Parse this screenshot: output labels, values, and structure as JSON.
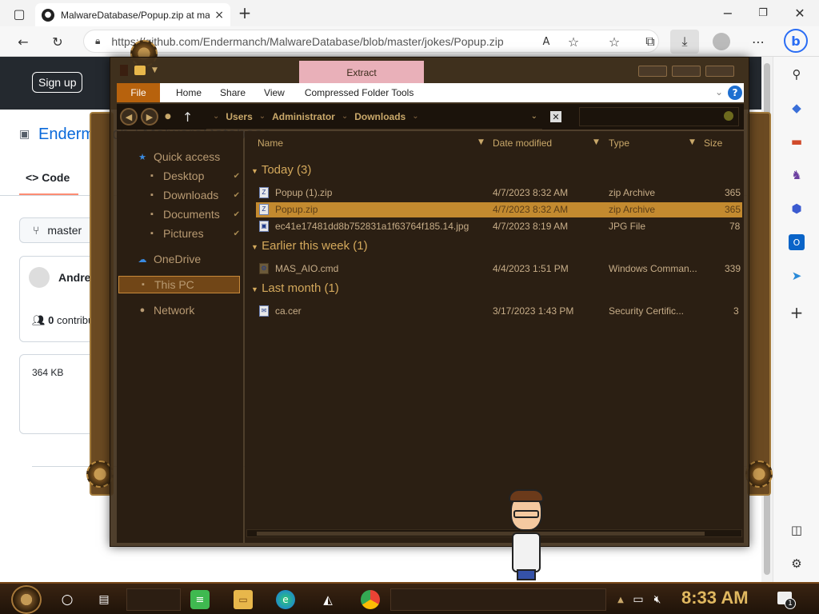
{
  "browser": {
    "tab_title": "MalwareDatabase/Popup.zip at master",
    "tab_close": "×",
    "url": "https://github.com/Endermanch/MalwareDatabase/blob/master/jokes/Popup.zip",
    "new_tab": "+"
  },
  "github": {
    "signup": "Sign up",
    "repo_name": "Endermanch / MalwareDatabase",
    "code_tab": "Code",
    "branch": "master",
    "author": "Andrew",
    "contributors_count": "0",
    "contributors_label": "contributors",
    "file_size": "364 KB"
  },
  "explorer": {
    "contextual_tab": "Extract",
    "ribbon": {
      "file": "File",
      "home": "Home",
      "share": "Share",
      "view": "View",
      "tools": "Compressed Folder Tools",
      "help": "?"
    },
    "breadcrumbs": [
      "Users",
      "Administrator",
      "Downloads"
    ],
    "columns": {
      "name": "Name",
      "date": "Date modified",
      "type": "Type",
      "size": "Size"
    },
    "nav": {
      "quick_access": "Quick access",
      "desktop": "Desktop",
      "downloads": "Downloads",
      "documents": "Documents",
      "pictures": "Pictures",
      "onedrive": "OneDrive",
      "this_pc": "This PC",
      "network": "Network"
    },
    "groups": {
      "today": "Today (3)",
      "earlier": "Earlier this week (1)",
      "last_month": "Last month (1)"
    },
    "files": [
      {
        "name": "Popup (1).zip",
        "date": "4/7/2023 8:32 AM",
        "type": "zip Archive",
        "size": "365"
      },
      {
        "name": "Popup.zip",
        "date": "4/7/2023 8:32 AM",
        "type": "zip Archive",
        "size": "365"
      },
      {
        "name": "ec41e17481dd8b752831a1f63764f185.14.jpg",
        "date": "4/7/2023 8:19 AM",
        "type": "JPG File",
        "size": "78"
      },
      {
        "name": "MAS_AIO.cmd",
        "date": "4/4/2023 1:51 PM",
        "type": "Windows Comman...",
        "size": "339"
      },
      {
        "name": "ca.cer",
        "date": "3/17/2023 1:43 PM",
        "type": "Security Certific...",
        "size": "3"
      }
    ]
  },
  "taskbar": {
    "time": "8:33 AM",
    "notification_count": "1"
  },
  "colors": {
    "accent": "#c38a2f",
    "gh_header": "#24292f",
    "explorer_bg": "#2b1f13"
  }
}
